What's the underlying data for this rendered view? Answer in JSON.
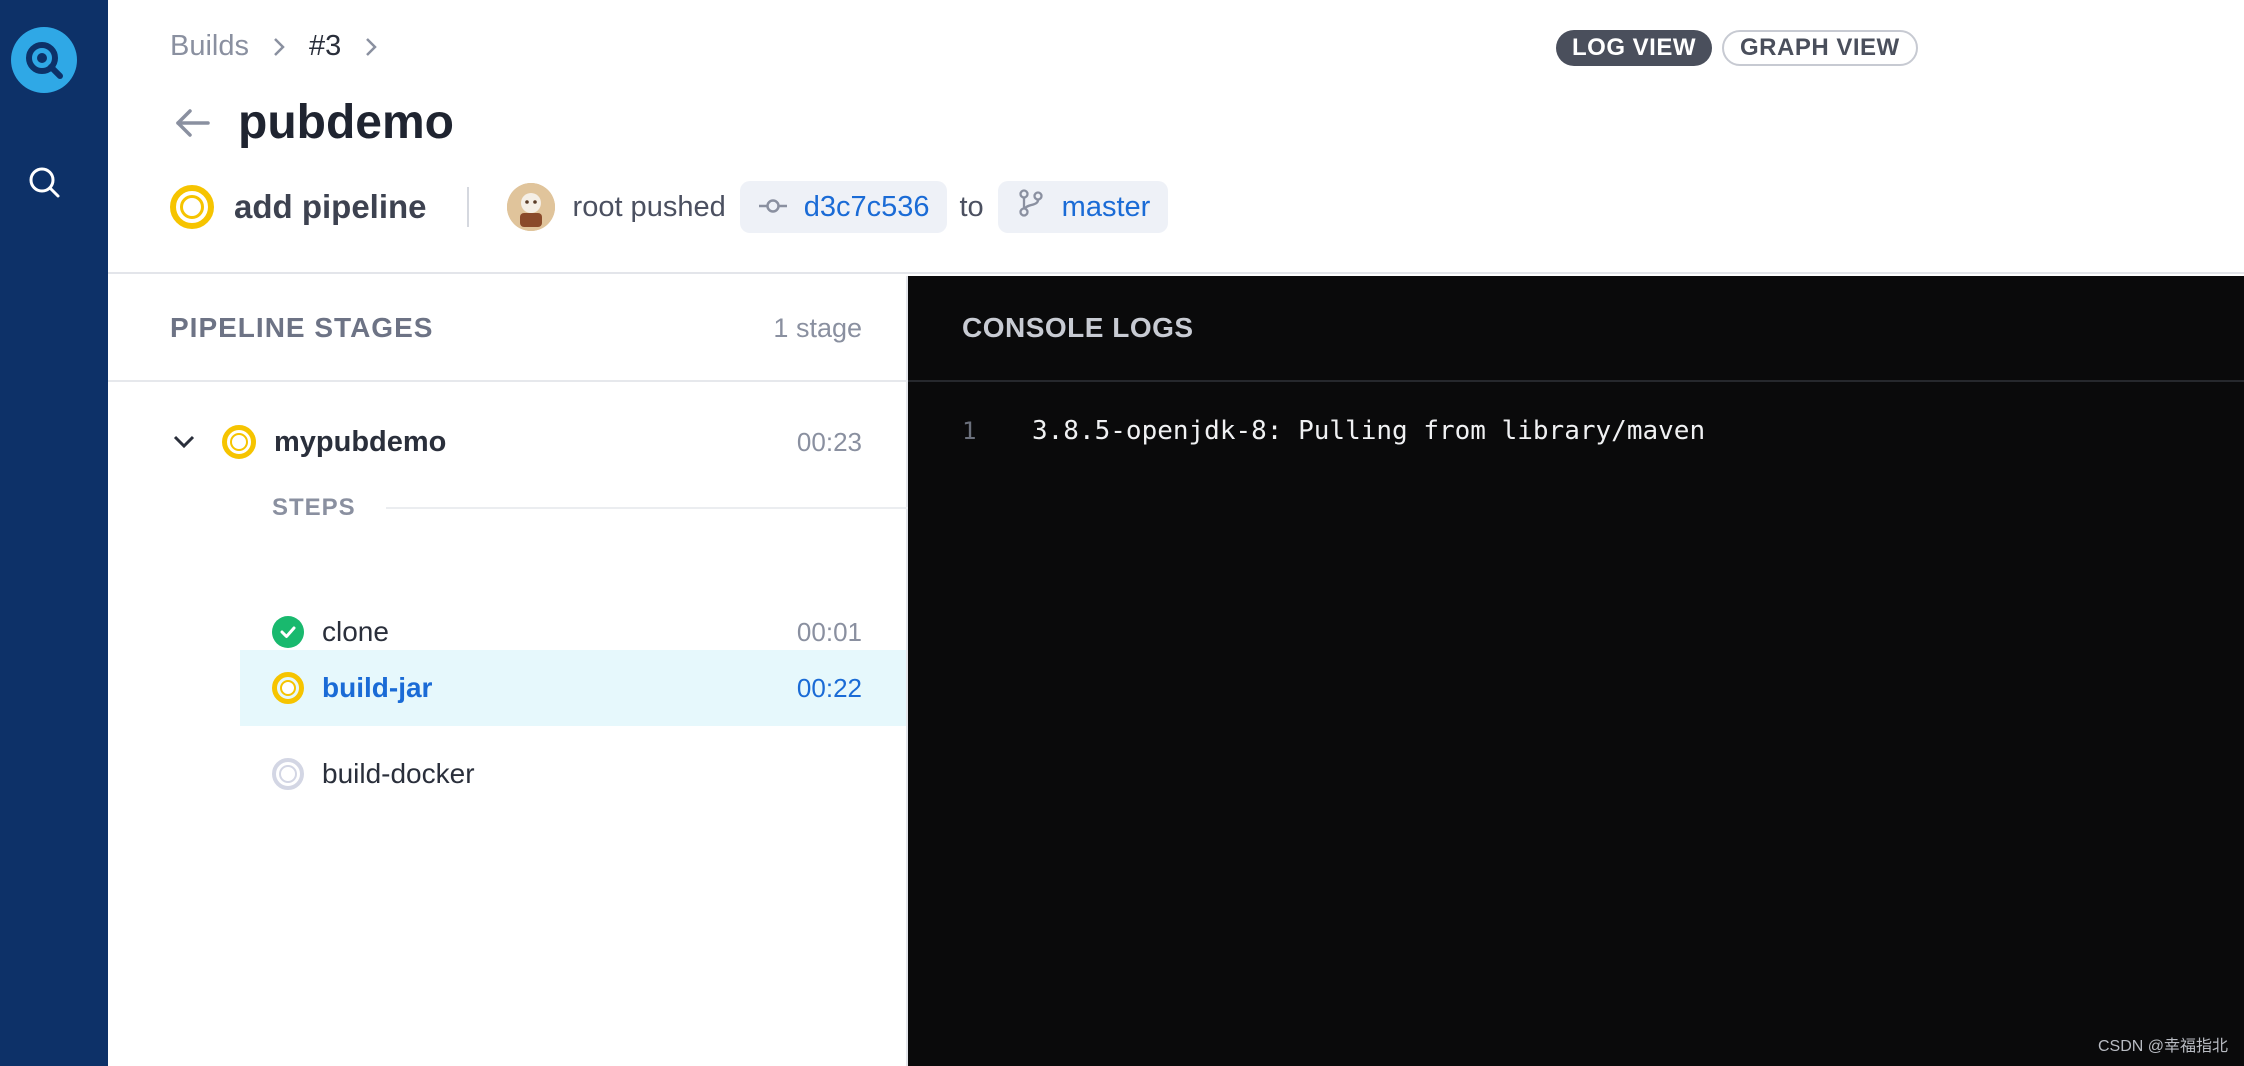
{
  "breadcrumb": {
    "root": "Builds",
    "build": "#3"
  },
  "views": {
    "log": "LOG VIEW",
    "graph": "GRAPH VIEW"
  },
  "repo": {
    "title": "pubdemo"
  },
  "commit": {
    "message": "add pipeline",
    "author_action": "root pushed",
    "sha": "d3c7c536",
    "to": "to",
    "branch": "master"
  },
  "stages": {
    "title": "PIPELINE STAGES",
    "count": "1 stage",
    "stage": {
      "name": "mypubdemo",
      "time": "00:23",
      "status": "running"
    },
    "steps_label": "STEPS",
    "steps": [
      {
        "name": "clone",
        "time": "00:01",
        "status": "success"
      },
      {
        "name": "build-jar",
        "time": "00:22",
        "status": "running"
      },
      {
        "name": "build-docker",
        "time": "",
        "status": "pending"
      }
    ]
  },
  "console": {
    "title": "CONSOLE LOGS",
    "lines": [
      {
        "num": "1",
        "text": "3.8.5-openjdk-8: Pulling from library/maven"
      }
    ]
  },
  "watermark": "CSDN @幸福指北",
  "colors": {
    "sidebar": "#0d3168",
    "running": "#f6c400",
    "success": "#19b96e",
    "link": "#1a6bd6",
    "console_bg": "#0a0a0b"
  }
}
